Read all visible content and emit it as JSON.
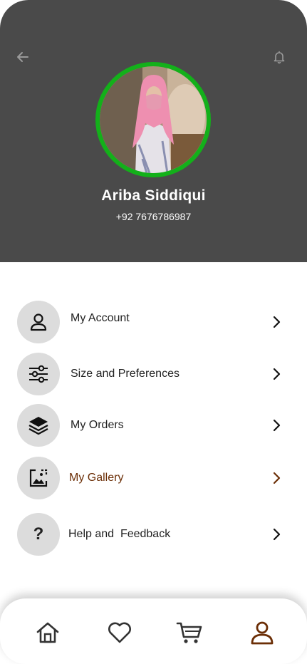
{
  "profile": {
    "name": "Ariba Siddiqui",
    "phone": "+92 7676786987"
  },
  "menu": [
    {
      "label": "My Account",
      "icon": "user-icon"
    },
    {
      "label": "Size and Preferences",
      "icon": "sliders-icon"
    },
    {
      "label": "My Orders",
      "icon": "layers-icon"
    },
    {
      "label": "My Gallery",
      "icon": "gallery-icon",
      "active": true
    },
    {
      "label": "Help and  Feedback",
      "icon": "question-icon"
    }
  ],
  "nav": [
    {
      "name": "home",
      "icon": "home-icon"
    },
    {
      "name": "wishlist",
      "icon": "heart-icon"
    },
    {
      "name": "cart",
      "icon": "cart-icon"
    },
    {
      "name": "profile",
      "icon": "user-icon",
      "active": true
    }
  ],
  "colors": {
    "header_bg": "#4a4a4a",
    "avatar_ring": "#13b01a",
    "accent": "#6b2e06",
    "icon_circle": "#dcdcdc"
  }
}
